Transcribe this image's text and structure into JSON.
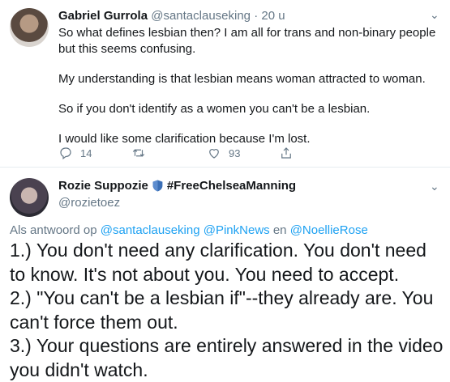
{
  "tweet": {
    "name": "Gabriel Gurrola",
    "handle": "@santaclauseking",
    "time": "· 20 u",
    "paragraphs": [
      "So what defines lesbian then? I am all for trans and non-binary people but this seems confusing.",
      "My understanding is that lesbian means woman attracted to woman.",
      "So if you don't identify as a women you can't be a lesbian.",
      "I would like some clarification because I'm lost."
    ],
    "actions": {
      "replies": "14",
      "retweets": "",
      "likes": "93"
    },
    "icons": [
      "reply-icon",
      "retweet-icon",
      "like-icon",
      "share-icon",
      "chevron-down-icon"
    ]
  },
  "reply": {
    "name": "Rozie Suppozie",
    "badge_icon": "blue-shield-icon",
    "hashtag": "#FreeChelseaManning",
    "handle": "@rozietoez",
    "replying_prefix": "Als antwoord op",
    "mention1": "@santaclauseking",
    "mention2": "@PinkNews",
    "joiner": "en",
    "mention3": "@NoellieRose",
    "lines": [
      "1.) You don't need any clarification. You don't need to know. It's not about you. You need to accept.",
      "2.) \"You can't be a lesbian if\"--they already are. You can't force them out.",
      "3.) Your questions are entirely answered in the video you didn't watch."
    ]
  },
  "colors": {
    "text": "#14171a",
    "secondary": "#657786",
    "link": "#1da1f2",
    "divider": "#e6ecf0",
    "shield": "#3b6fb6"
  }
}
